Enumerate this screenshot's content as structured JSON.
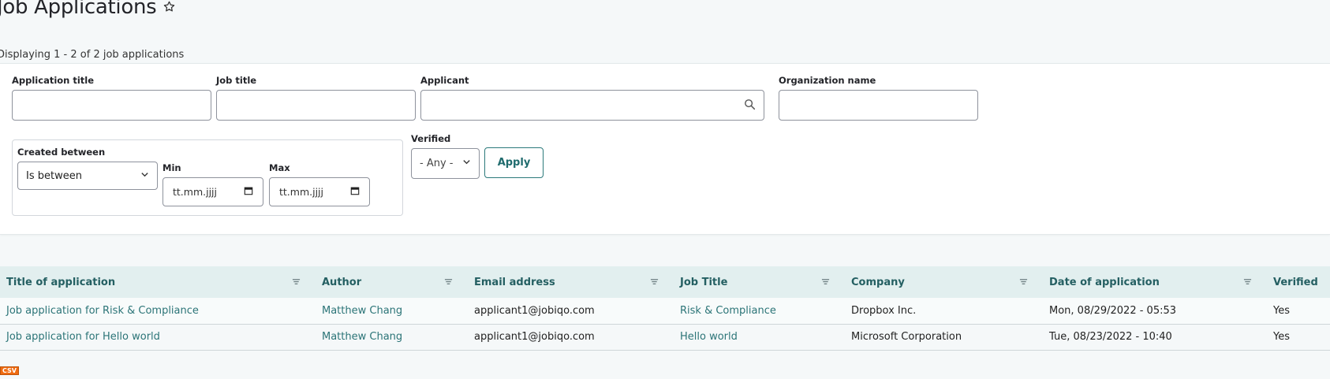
{
  "page": {
    "title": "Job Applications",
    "summary": "Displaying 1 - 2 of 2 job applications"
  },
  "filters": {
    "application_title": {
      "label": "Application title",
      "value": ""
    },
    "job_title": {
      "label": "Job title",
      "value": ""
    },
    "applicant": {
      "label": "Applicant",
      "value": ""
    },
    "organization_name": {
      "label": "Organization name",
      "value": ""
    },
    "created_between": {
      "label": "Created between",
      "operator": "Is between",
      "min_label": "Min",
      "max_label": "Max",
      "min_placeholder": "tt.mm.jjjj",
      "max_placeholder": "tt.mm.jjjj"
    },
    "verified": {
      "label": "Verified",
      "value": "- Any -"
    },
    "apply_label": "Apply"
  },
  "table": {
    "columns": [
      "Title of application",
      "Author",
      "Email address",
      "Job Title",
      "Company",
      "Date of application",
      "Verified"
    ],
    "rows": [
      {
        "title": "Job application for Risk & Compliance",
        "author": "Matthew Chang",
        "email": "applicant1@jobiqo.com",
        "job_title": "Risk & Compliance",
        "company": "Dropbox Inc.",
        "date": "Mon, 08/29/2022 - 05:53",
        "verified": "Yes"
      },
      {
        "title": "Job application for Hello world",
        "author": "Matthew Chang",
        "email": "applicant1@jobiqo.com",
        "job_title": "Hello world",
        "company": "Microsoft Corporation",
        "date": "Tue, 08/23/2022 - 10:40",
        "verified": "Yes"
      }
    ]
  },
  "export": {
    "csv_label": "CSV"
  },
  "colors": {
    "accent": "#2b7477",
    "header_bg": "#e2efef",
    "csv_badge": "#f06b11"
  },
  "icons": {
    "favorite": "star-icon",
    "search": "search-icon",
    "sort": "sort-icon",
    "dropdown": "chevron-down-icon",
    "date": "calendar-icon"
  }
}
